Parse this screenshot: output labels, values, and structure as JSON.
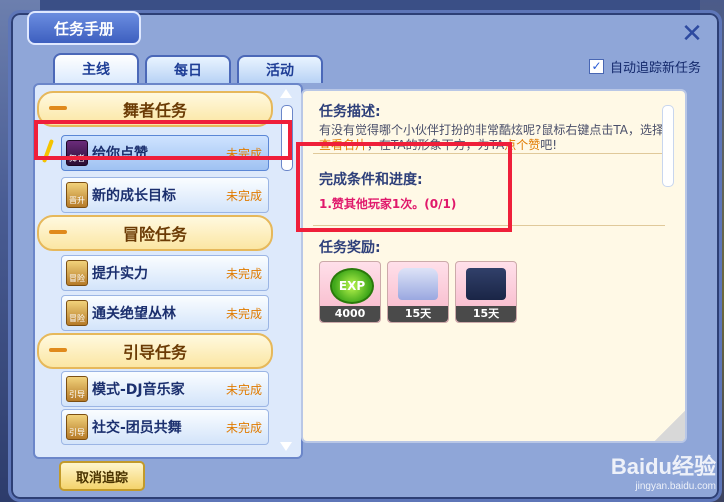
{
  "window": {
    "title": "任务手册",
    "close_glyph": "✕"
  },
  "tabs": [
    {
      "label": "主线",
      "active": true
    },
    {
      "label": "每日",
      "active": false
    },
    {
      "label": "活动",
      "active": false
    }
  ],
  "auto_track": {
    "label": "自动追踪新任务",
    "checked": true
  },
  "categories": [
    {
      "title": "舞者任务"
    },
    {
      "title": "冒险任务"
    },
    {
      "title": "引导任务"
    }
  ],
  "items": [
    {
      "icon_text": "舞者",
      "label": "给你点赞",
      "status": "未完成"
    },
    {
      "icon_text": "晋升",
      "label": "新的成长目标",
      "status": "未完成"
    },
    {
      "icon_text": "冒险",
      "label": "提升实力",
      "status": "未完成"
    },
    {
      "icon_text": "冒险",
      "label": "通关绝望丛林",
      "status": "未完成"
    },
    {
      "icon_text": "引导",
      "label": "模式-DJ音乐家",
      "status": "未完成"
    },
    {
      "icon_text": "引导",
      "label": "社交-团员共舞",
      "status": "未完成"
    }
  ],
  "detail": {
    "desc_title": "任务描述:",
    "desc_line1": "有没有觉得哪个小伙伴打扮的非常酷炫呢?鼠标右键点击TA，选择",
    "desc_hl1": "查看名片",
    "desc_mid": "，在TA的形象下方，为TA",
    "desc_hl2": "点个赞",
    "desc_end": "吧!",
    "cond_title": "完成条件和进度:",
    "cond_text": "1.赞其他玩家1次。(0/1)",
    "reward_title": "任务奖励:",
    "rewards": [
      {
        "kind": "exp",
        "art_text": "EXP",
        "qty": "4000"
      },
      {
        "kind": "shirt",
        "qty": "15天"
      },
      {
        "kind": "shorts",
        "qty": "15天"
      }
    ]
  },
  "cancel_button": {
    "label": "取消追踪"
  },
  "watermark": {
    "logo": "Baidu经验",
    "url": "jingyan.baidu.com"
  },
  "colors": {
    "status": "#e07b00",
    "progress": "#e0186b",
    "highlight_box": "#ef1f3a"
  }
}
